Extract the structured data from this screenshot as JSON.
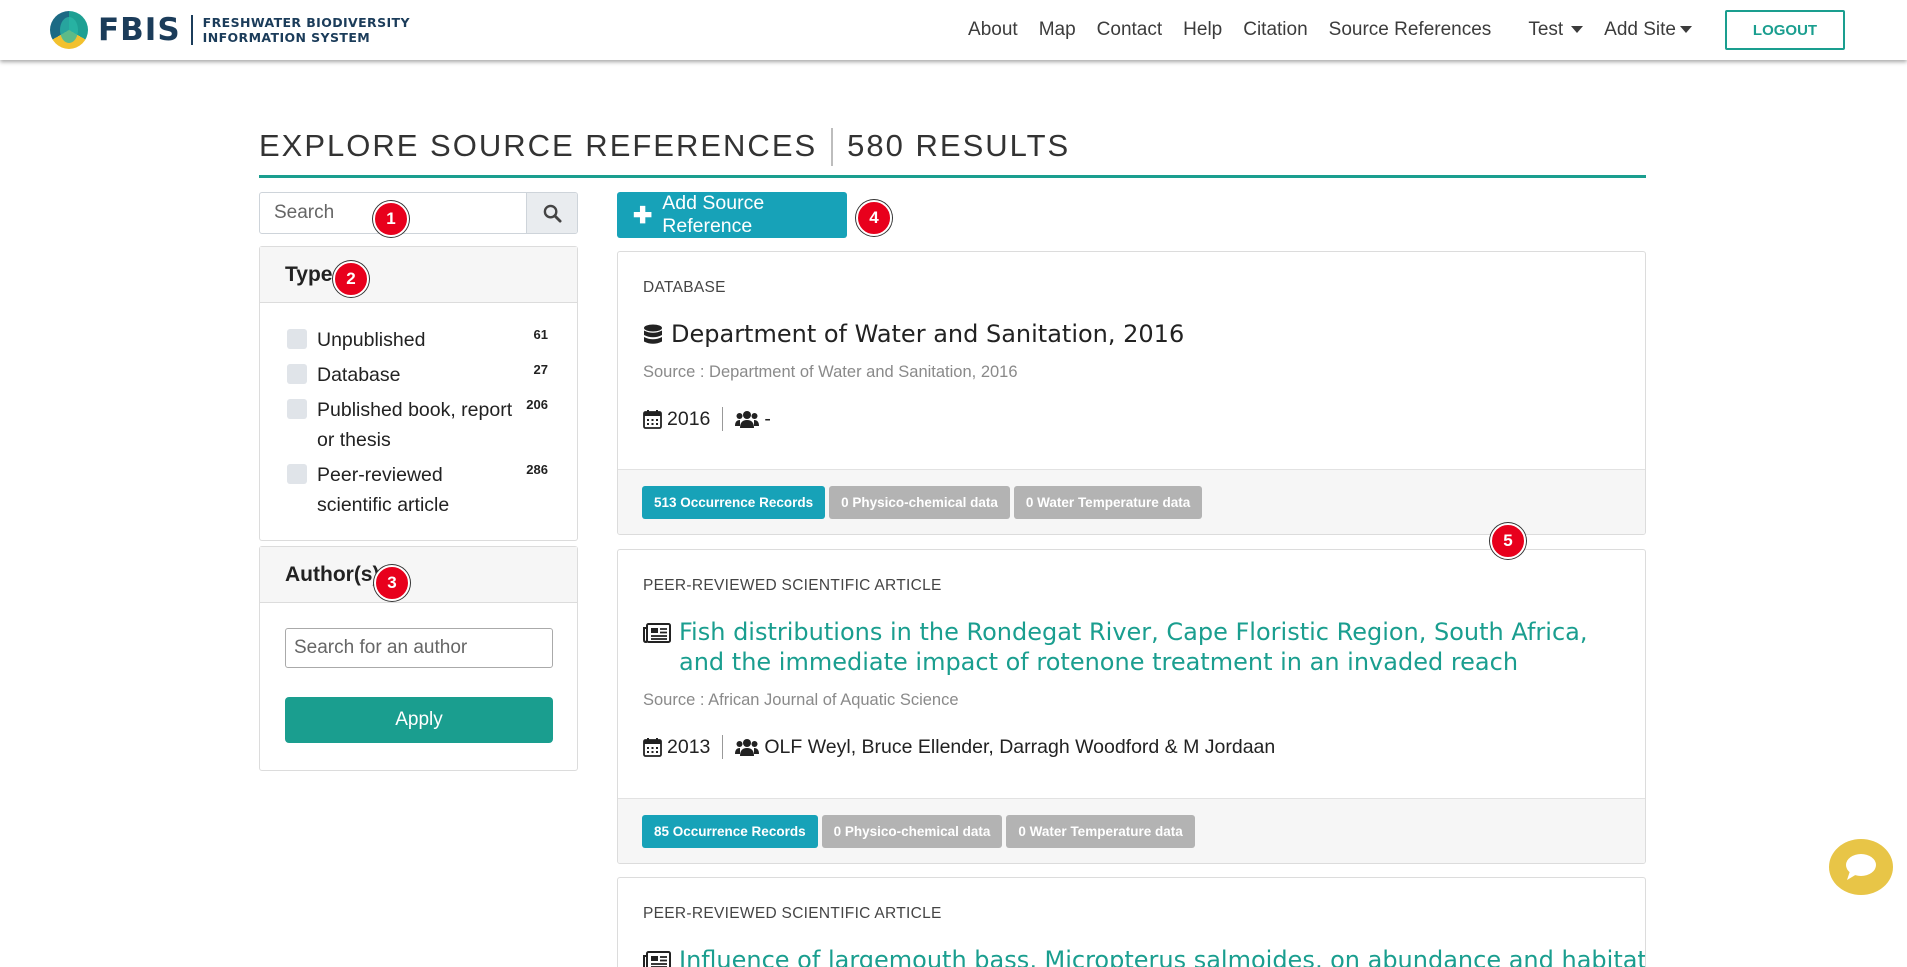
{
  "brand": {
    "name": "FBIS",
    "subtitle_line1": "FRESHWATER BIODIVERSITY",
    "subtitle_line2": "INFORMATION SYSTEM"
  },
  "nav": {
    "about": "About",
    "map": "Map",
    "contact": "Contact",
    "help": "Help",
    "citation": "Citation",
    "source_references": "Source References",
    "test": "Test",
    "add_site": "Add Site",
    "logout": "LOGOUT"
  },
  "header": {
    "title": "EXPLORE SOURCE REFERENCES",
    "results": "580 RESULTS"
  },
  "search": {
    "placeholder": "Search"
  },
  "type_filter": {
    "title": "Type",
    "items": [
      {
        "label": "Unpublished",
        "count": "61"
      },
      {
        "label": "Database",
        "count": "27"
      },
      {
        "label": "Published book, report or thesis",
        "count": "206"
      },
      {
        "label": "Peer-reviewed scientific article",
        "count": "286"
      }
    ]
  },
  "author_filter": {
    "title": "Author(s)",
    "placeholder": "Search for an author",
    "apply": "Apply"
  },
  "main": {
    "add_button": "Add Source Reference"
  },
  "references": [
    {
      "type": "DATABASE",
      "icon": "database-icon",
      "title": "Department of Water and Sanitation, 2016",
      "source": "Source : Department of Water and Sanitation, 2016",
      "year": "2016",
      "authors": "-",
      "occurrence": "513 Occurrence Records",
      "physico": "0 Physico-chemical data",
      "water_temp": "0 Water Temperature data"
    },
    {
      "type": "PEER-REVIEWED SCIENTIFIC ARTICLE",
      "icon": "newspaper-icon",
      "title": "Fish distributions in the Rondegat River, Cape Floristic Region, South Africa, and the immediate impact of rotenone treatment in an invaded reach",
      "source": "Source : African Journal of Aquatic Science",
      "year": "2013",
      "authors": "OLF Weyl, Bruce Ellender, Darragh Woodford & M Jordaan",
      "occurrence": "85 Occurrence Records",
      "physico": "0 Physico-chemical data",
      "water_temp": "0 Water Temperature data"
    },
    {
      "type": "PEER-REVIEWED SCIENTIFIC ARTICLE",
      "icon": "newspaper-icon",
      "title": "Influence of largemouth bass, Micropterus salmoides, on abundance and habitat"
    }
  ],
  "markers": [
    "1",
    "2",
    "3",
    "4",
    "5"
  ],
  "colors": {
    "accent": "#1a9e8f",
    "info": "#17a2b8",
    "muted_badge": "#b3b3b3",
    "marker": "#e8001c",
    "chat": "#e8c547"
  }
}
